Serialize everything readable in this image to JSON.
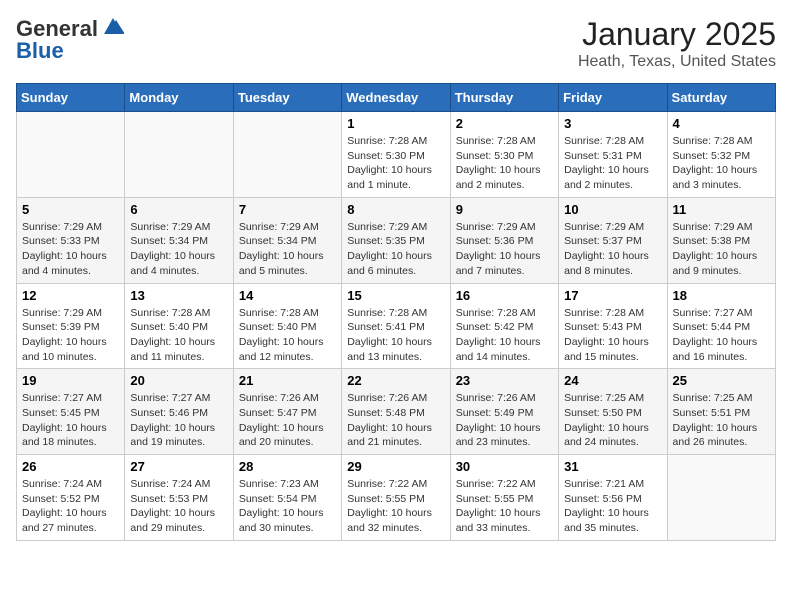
{
  "logo": {
    "line1": "General",
    "line2": "Blue"
  },
  "title": "January 2025",
  "subtitle": "Heath, Texas, United States",
  "days_of_week": [
    "Sunday",
    "Monday",
    "Tuesday",
    "Wednesday",
    "Thursday",
    "Friday",
    "Saturday"
  ],
  "weeks": [
    [
      {
        "num": "",
        "info": ""
      },
      {
        "num": "",
        "info": ""
      },
      {
        "num": "",
        "info": ""
      },
      {
        "num": "1",
        "info": "Sunrise: 7:28 AM\nSunset: 5:30 PM\nDaylight: 10 hours\nand 1 minute."
      },
      {
        "num": "2",
        "info": "Sunrise: 7:28 AM\nSunset: 5:30 PM\nDaylight: 10 hours\nand 2 minutes."
      },
      {
        "num": "3",
        "info": "Sunrise: 7:28 AM\nSunset: 5:31 PM\nDaylight: 10 hours\nand 2 minutes."
      },
      {
        "num": "4",
        "info": "Sunrise: 7:28 AM\nSunset: 5:32 PM\nDaylight: 10 hours\nand 3 minutes."
      }
    ],
    [
      {
        "num": "5",
        "info": "Sunrise: 7:29 AM\nSunset: 5:33 PM\nDaylight: 10 hours\nand 4 minutes."
      },
      {
        "num": "6",
        "info": "Sunrise: 7:29 AM\nSunset: 5:34 PM\nDaylight: 10 hours\nand 4 minutes."
      },
      {
        "num": "7",
        "info": "Sunrise: 7:29 AM\nSunset: 5:34 PM\nDaylight: 10 hours\nand 5 minutes."
      },
      {
        "num": "8",
        "info": "Sunrise: 7:29 AM\nSunset: 5:35 PM\nDaylight: 10 hours\nand 6 minutes."
      },
      {
        "num": "9",
        "info": "Sunrise: 7:29 AM\nSunset: 5:36 PM\nDaylight: 10 hours\nand 7 minutes."
      },
      {
        "num": "10",
        "info": "Sunrise: 7:29 AM\nSunset: 5:37 PM\nDaylight: 10 hours\nand 8 minutes."
      },
      {
        "num": "11",
        "info": "Sunrise: 7:29 AM\nSunset: 5:38 PM\nDaylight: 10 hours\nand 9 minutes."
      }
    ],
    [
      {
        "num": "12",
        "info": "Sunrise: 7:29 AM\nSunset: 5:39 PM\nDaylight: 10 hours\nand 10 minutes."
      },
      {
        "num": "13",
        "info": "Sunrise: 7:28 AM\nSunset: 5:40 PM\nDaylight: 10 hours\nand 11 minutes."
      },
      {
        "num": "14",
        "info": "Sunrise: 7:28 AM\nSunset: 5:40 PM\nDaylight: 10 hours\nand 12 minutes."
      },
      {
        "num": "15",
        "info": "Sunrise: 7:28 AM\nSunset: 5:41 PM\nDaylight: 10 hours\nand 13 minutes."
      },
      {
        "num": "16",
        "info": "Sunrise: 7:28 AM\nSunset: 5:42 PM\nDaylight: 10 hours\nand 14 minutes."
      },
      {
        "num": "17",
        "info": "Sunrise: 7:28 AM\nSunset: 5:43 PM\nDaylight: 10 hours\nand 15 minutes."
      },
      {
        "num": "18",
        "info": "Sunrise: 7:27 AM\nSunset: 5:44 PM\nDaylight: 10 hours\nand 16 minutes."
      }
    ],
    [
      {
        "num": "19",
        "info": "Sunrise: 7:27 AM\nSunset: 5:45 PM\nDaylight: 10 hours\nand 18 minutes."
      },
      {
        "num": "20",
        "info": "Sunrise: 7:27 AM\nSunset: 5:46 PM\nDaylight: 10 hours\nand 19 minutes."
      },
      {
        "num": "21",
        "info": "Sunrise: 7:26 AM\nSunset: 5:47 PM\nDaylight: 10 hours\nand 20 minutes."
      },
      {
        "num": "22",
        "info": "Sunrise: 7:26 AM\nSunset: 5:48 PM\nDaylight: 10 hours\nand 21 minutes."
      },
      {
        "num": "23",
        "info": "Sunrise: 7:26 AM\nSunset: 5:49 PM\nDaylight: 10 hours\nand 23 minutes."
      },
      {
        "num": "24",
        "info": "Sunrise: 7:25 AM\nSunset: 5:50 PM\nDaylight: 10 hours\nand 24 minutes."
      },
      {
        "num": "25",
        "info": "Sunrise: 7:25 AM\nSunset: 5:51 PM\nDaylight: 10 hours\nand 26 minutes."
      }
    ],
    [
      {
        "num": "26",
        "info": "Sunrise: 7:24 AM\nSunset: 5:52 PM\nDaylight: 10 hours\nand 27 minutes."
      },
      {
        "num": "27",
        "info": "Sunrise: 7:24 AM\nSunset: 5:53 PM\nDaylight: 10 hours\nand 29 minutes."
      },
      {
        "num": "28",
        "info": "Sunrise: 7:23 AM\nSunset: 5:54 PM\nDaylight: 10 hours\nand 30 minutes."
      },
      {
        "num": "29",
        "info": "Sunrise: 7:22 AM\nSunset: 5:55 PM\nDaylight: 10 hours\nand 32 minutes."
      },
      {
        "num": "30",
        "info": "Sunrise: 7:22 AM\nSunset: 5:55 PM\nDaylight: 10 hours\nand 33 minutes."
      },
      {
        "num": "31",
        "info": "Sunrise: 7:21 AM\nSunset: 5:56 PM\nDaylight: 10 hours\nand 35 minutes."
      },
      {
        "num": "",
        "info": ""
      }
    ]
  ]
}
